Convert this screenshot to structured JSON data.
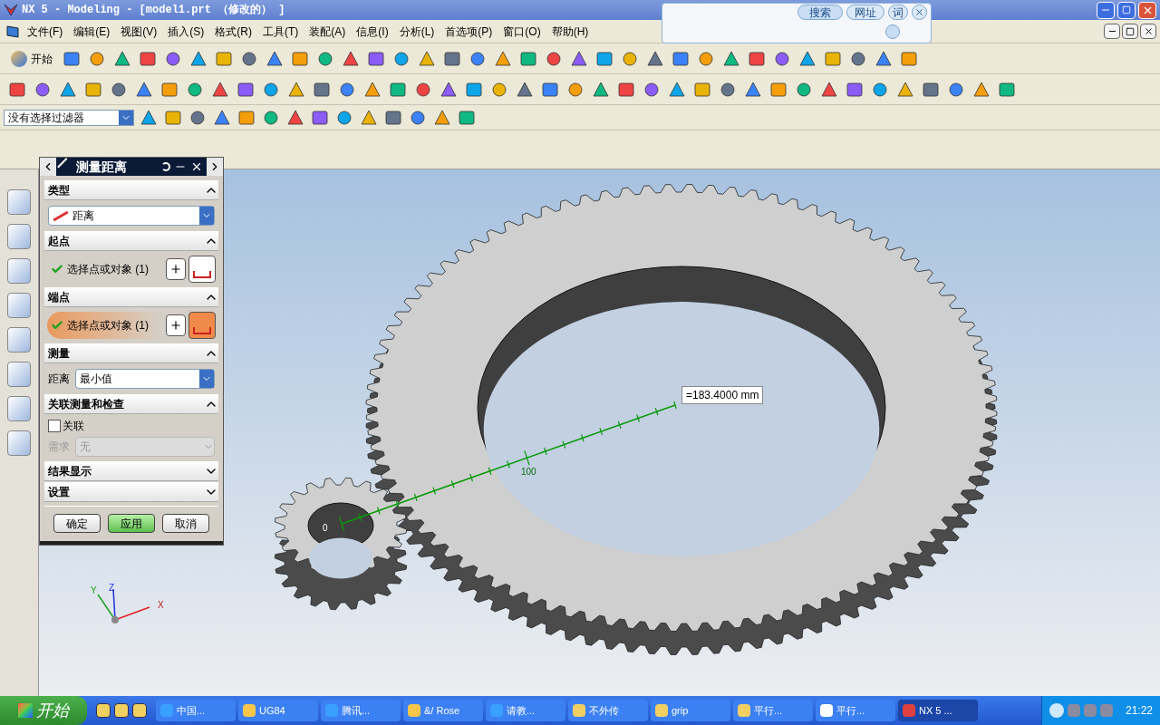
{
  "window": {
    "title": "NX 5 - Modeling - [model1.prt （修改的） ]"
  },
  "search_widget": {
    "search": "搜索",
    "url": "网址",
    "word": "词"
  },
  "menu": [
    "文件(F)",
    "编辑(E)",
    "视图(V)",
    "插入(S)",
    "格式(R)",
    "工具(T)",
    "装配(A)",
    "信息(I)",
    "分析(L)",
    "首选项(P)",
    "窗口(O)",
    "帮助(H)"
  ],
  "toolbar": {
    "start": "开始",
    "filter": "没有选择过滤器"
  },
  "dialog": {
    "title": "测量距离",
    "sections": [
      {
        "kind": "type",
        "title": "类型",
        "expanded": true,
        "value": "距离"
      },
      {
        "kind": "point",
        "title": "起点",
        "expanded": true,
        "label": "选择点或对象 (1)",
        "active": false
      },
      {
        "kind": "point",
        "title": "端点",
        "expanded": true,
        "label": "选择点或对象 (1)",
        "active": true
      },
      {
        "kind": "measure",
        "title": "测量",
        "expanded": true,
        "label": "距离",
        "value": "最小值"
      },
      {
        "kind": "assoc",
        "title": "关联测量和检查",
        "expanded": true,
        "checkbox": "关联",
        "checked": false,
        "req_label": "需求",
        "req_value": "无",
        "disabled": true
      },
      {
        "kind": "plain",
        "title": "结果显示",
        "expanded": false
      },
      {
        "kind": "plain",
        "title": "设置",
        "expanded": false
      }
    ],
    "buttons": [
      {
        "label": "确定",
        "selected": false
      },
      {
        "label": "应用",
        "selected": true
      },
      {
        "label": "取消",
        "selected": false
      }
    ]
  },
  "viewport": {
    "measurement": "=183.4000 mm",
    "scale_labels": [
      "0",
      "100"
    ],
    "axes": [
      "X",
      "Y",
      "Z"
    ]
  },
  "taskbar": {
    "start": "开始",
    "items": [
      {
        "label": "中国...",
        "kind": "browser",
        "selected": false
      },
      {
        "label": "UG84",
        "kind": "folder-doc",
        "selected": false
      },
      {
        "label": "腾讯...",
        "kind": "browser",
        "selected": false
      },
      {
        "label": "&/ Rose",
        "kind": "folder-doc",
        "selected": false
      },
      {
        "label": "请教...",
        "kind": "browser",
        "selected": false
      },
      {
        "label": "不外传",
        "kind": "folder",
        "selected": false
      },
      {
        "label": "grip",
        "kind": "folder",
        "selected": false
      },
      {
        "label": "平行...",
        "kind": "folder",
        "selected": false
      },
      {
        "label": "平行...",
        "kind": "notepad",
        "selected": false
      },
      {
        "label": "NX 5 ...",
        "kind": "app",
        "selected": true
      }
    ],
    "clock": "21:22"
  }
}
